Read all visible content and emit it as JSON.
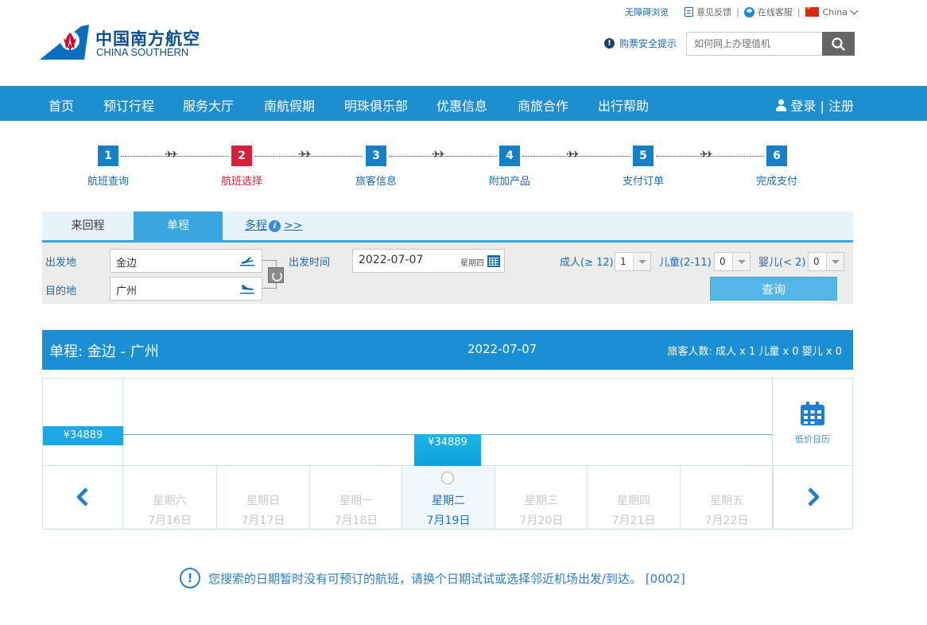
{
  "header": {
    "logo_cn": "中国南方航空",
    "logo_en": "CHINA SOUTHERN",
    "links": {
      "accessible": "无障碍浏览",
      "feedback": "意见反馈",
      "online_service": "在线客服",
      "region": "China",
      "sep": "|"
    },
    "safety_tip": "购票安全提示",
    "search_placeholder": "如何网上办理值机"
  },
  "nav": {
    "items": [
      "首页",
      "预订行程",
      "服务大厅",
      "南航假期",
      "明珠俱乐部",
      "优惠信息",
      "商旅合作",
      "出行帮助"
    ],
    "login": "登录 | 注册"
  },
  "steps": [
    {
      "num": "1",
      "label": "航班查询"
    },
    {
      "num": "2",
      "label": "航班选择"
    },
    {
      "num": "3",
      "label": "旅客信息"
    },
    {
      "num": "4",
      "label": "附加产品"
    },
    {
      "num": "5",
      "label": "支付订单"
    },
    {
      "num": "6",
      "label": "完成支付"
    }
  ],
  "active_step": 2,
  "search_panel": {
    "tabs": {
      "round_trip": "来回程",
      "one_way": "单程",
      "multi": "多程",
      "multi_suffix": ">>"
    },
    "origin_label": "出发地",
    "origin_value": "金边",
    "dest_label": "目的地",
    "dest_value": "广州",
    "date_label": "出发时间",
    "date_value": "2022-07-07",
    "date_weekday": "星期四",
    "adult_label": "成人(≥ 12)",
    "adult_value": "1",
    "child_label": "儿童(2-11)",
    "child_value": "0",
    "infant_label": "婴儿(< 2)",
    "infant_value": "0",
    "query_button": "查询"
  },
  "result": {
    "route": "单程:  金边  -  广州",
    "date": "2022-07-07",
    "passengers": "旅客人数: 成人 x 1   儿童 x 0   婴儿 x 0",
    "low_price": "¥34889",
    "selected_price": "¥34889",
    "calendar_label": "低价日历",
    "days": [
      {
        "week": "星期六",
        "date": "7月16日"
      },
      {
        "week": "星期日",
        "date": "7月17日"
      },
      {
        "week": "星期一",
        "date": "7月18日"
      },
      {
        "week": "星期二",
        "date": "7月19日"
      },
      {
        "week": "星期三",
        "date": "7月20日"
      },
      {
        "week": "星期四",
        "date": "7月21日"
      },
      {
        "week": "星期五",
        "date": "7月22日"
      }
    ],
    "selected_day_index": 3
  },
  "notice": "您搜索的日期暂时没有可预订的航班，请换个日期试试或选择邻近机场出发/到达。 [0002]",
  "colors": {
    "brand_blue": "#1d8fd0",
    "active_red": "#d81e3a",
    "logo_red": "#c8102e",
    "logo_blue": "#0a6fbe"
  }
}
